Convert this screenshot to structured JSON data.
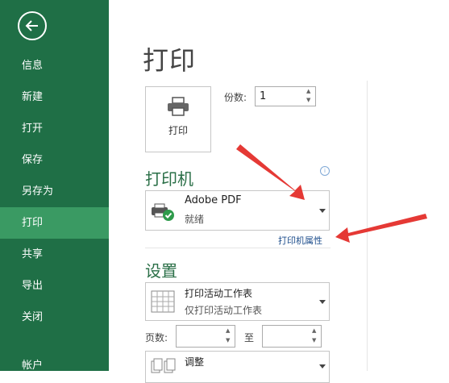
{
  "sidebar": {
    "back_icon": "arrow-left-icon",
    "items": [
      {
        "label": "信息"
      },
      {
        "label": "新建"
      },
      {
        "label": "打开"
      },
      {
        "label": "保存"
      },
      {
        "label": "另存为"
      },
      {
        "label": "打印"
      },
      {
        "label": "共享"
      },
      {
        "label": "导出"
      },
      {
        "label": "关闭"
      },
      {
        "label": "帐户"
      }
    ],
    "active_item": "打印",
    "colors": {
      "background": "#1f6f46",
      "active": "#3a9a63"
    }
  },
  "main": {
    "title": "打印",
    "print_button": {
      "label": "打印",
      "icon": "printer-icon"
    },
    "copies": {
      "label": "份数:",
      "value": "1"
    },
    "printer_section": {
      "title": "打印机",
      "info_icon": "info-icon",
      "selected_printer": {
        "name": "Adobe PDF",
        "status": "就绪",
        "icon": "printer-ready-icon"
      },
      "properties_link": "打印机属性"
    },
    "settings_section": {
      "title": "设置",
      "scope": {
        "title": "打印活动工作表",
        "description": "仅打印活动工作表",
        "icon": "worksheet-grid-icon"
      },
      "pages_label": "页数:",
      "to_label": "至",
      "collate": {
        "title": "调整",
        "icon": "collate-pages-icon"
      }
    },
    "accent_color": "#2a6f47",
    "annotation_arrow_color": "#e53935"
  }
}
